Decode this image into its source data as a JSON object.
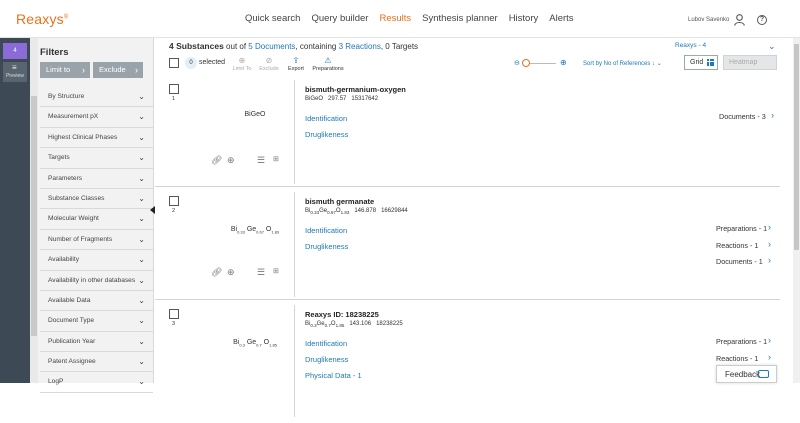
{
  "app": {
    "logo": "Reaxys",
    "logo_mark": "®"
  },
  "nav": [
    "Quick search",
    "Query builder",
    "Results",
    "Synthesis planner",
    "History",
    "Alerts"
  ],
  "user": {
    "name": "Lubov Savenko"
  },
  "rail": {
    "badge": "4",
    "preview": "Preview"
  },
  "filters": {
    "title": "Filters",
    "limit_to": "Limit to",
    "exclude": "Exclude",
    "items": [
      "By Structure",
      "Measurement pX",
      "Highest Clinical Phases",
      "Targets",
      "Parameters",
      "Substance Classes",
      "Molecular Weight",
      "Number of Fragments",
      "Availability",
      "Availability in other databases",
      "Available Data",
      "Document Type",
      "Publication Year",
      "Patent Assignee",
      "LogP"
    ]
  },
  "summary": {
    "count": "4 Substances",
    "out_of": "out of",
    "documents": "5 Documents",
    "containing": ", containing",
    "reactions": "3 Reactions",
    "targets": ", 0 Targets",
    "reaxys_tag": "Reaxys - 4"
  },
  "toolbar": {
    "selected_count": "0",
    "selected_label": "selected",
    "limit_to": "Limit To",
    "exclude": "Exclude",
    "export": "Export",
    "preparations": "Preparations",
    "sort_by": "Sort by No of References",
    "grid": "Grid",
    "heatmap": "Heatmap"
  },
  "records": [
    {
      "num": "1",
      "structure": "BiGeO",
      "name": "bismuth-germanium-oxygen",
      "formula": "BiGeO",
      "mw": "297.57",
      "id": "15317642",
      "links": [
        "Identification",
        "Druglikeness"
      ],
      "right": [
        "Documents - 3"
      ]
    },
    {
      "num": "2",
      "structure": "Bi 0.33 Ge 0.67 O 1.83",
      "name": "bismuth germanate",
      "formula": "Bi0.33Ge0.67O1.83",
      "mw": "146.878",
      "id": "16629844",
      "links": [
        "Identification",
        "Druglikeness"
      ],
      "right": [
        "Preparations - 1",
        "Reactions - 1",
        "Documents - 1"
      ]
    },
    {
      "num": "3",
      "structure": "Bi 0.3 Ge 0.7 O 1.85",
      "name": "Reaxys ID: 18238225",
      "formula": "Bi0.3Ge0.7O1.85",
      "mw": "143.106",
      "id": "18238225",
      "links": [
        "Identification",
        "Druglikeness",
        "Physical Data - 1"
      ],
      "right": [
        "Preparations - 1",
        "Reactions - 1"
      ]
    }
  ],
  "feedback": "Feedback"
}
